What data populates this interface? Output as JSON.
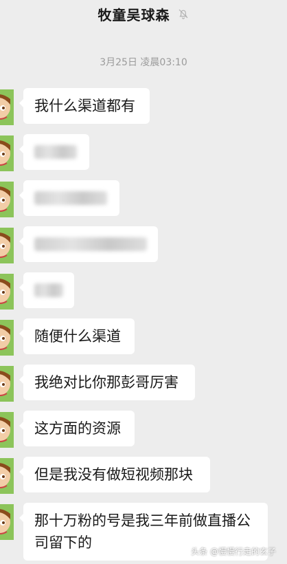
{
  "header": {
    "title": "牧童吴球森",
    "mute_icon": "bell-off-icon"
  },
  "timestamp": "3月25日 凌晨03:10",
  "messages": [
    {
      "text": "我什么渠道都有",
      "blurred": false
    },
    {
      "text": "",
      "blurred": true
    },
    {
      "text": "",
      "blurred": true
    },
    {
      "text": "",
      "blurred": true
    },
    {
      "text": "",
      "blurred": true
    },
    {
      "text": "随便什么渠道",
      "blurred": false
    },
    {
      "text": "我绝对比你那彭哥厉害",
      "blurred": false
    },
    {
      "text": "这方面的资源",
      "blurred": false
    },
    {
      "text": "但是我没有做短视频那块",
      "blurred": false
    },
    {
      "text": "那十万粉的号是我三年前做直播公司留下的",
      "blurred": false
    }
  ],
  "watermark": "头条 @慢慢行走的玄子"
}
